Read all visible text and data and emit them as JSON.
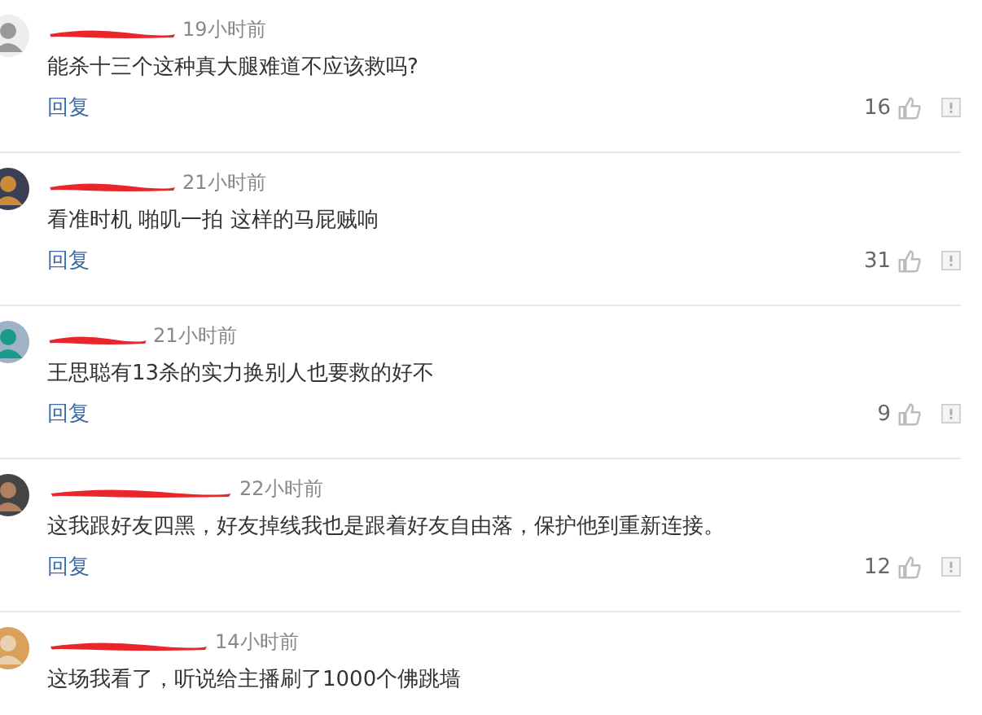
{
  "comments": [
    {
      "time": "19小时前",
      "text": "能杀十三个这种真大腿难道不应该救吗?",
      "reply": "回复",
      "likes": "16"
    },
    {
      "time": "21小时前",
      "text": "看准时机 啪叽一拍 这样的马屁贼响",
      "reply": "回复",
      "likes": "31"
    },
    {
      "time": "21小时前",
      "text": "王思聪有13杀的实力换别人也要救的好不",
      "reply": "回复",
      "likes": "9"
    },
    {
      "time": "22小时前",
      "text": "这我跟好友四黑，好友掉线我也是跟着好友自由落，保护他到重新连接。",
      "reply": "回复",
      "likes": "12"
    },
    {
      "time": "14小时前",
      "text": "这场我看了，听说给主播刷了1000个佛跳墙"
    }
  ]
}
